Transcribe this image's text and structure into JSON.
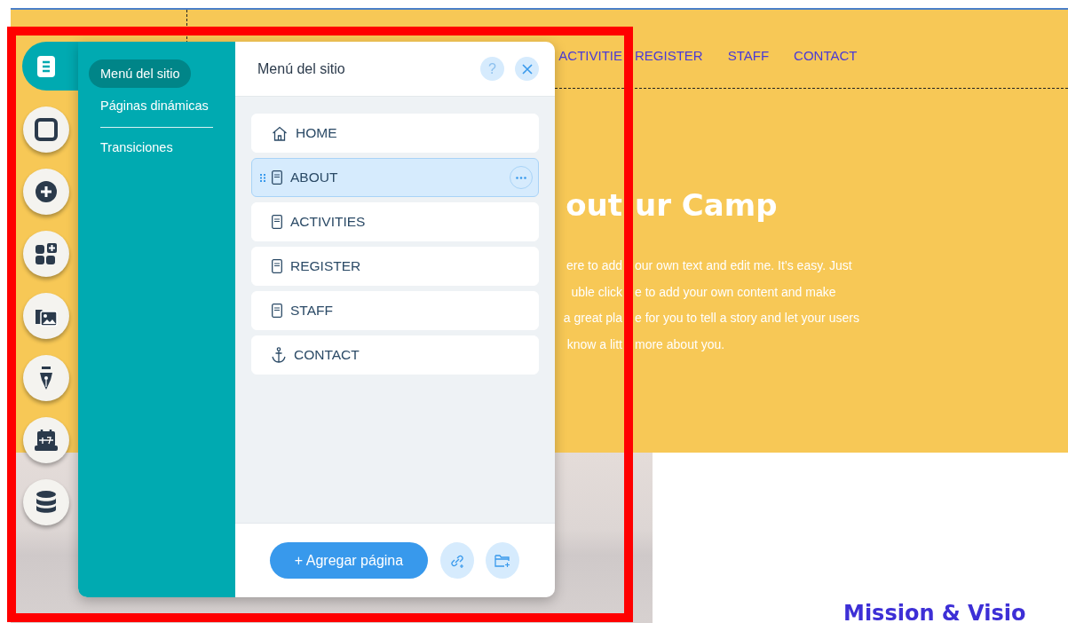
{
  "site": {
    "nav": [
      {
        "label": "ACTIVITIE"
      },
      {
        "label": "REGISTER"
      },
      {
        "label": "STAFF"
      },
      {
        "label": "CONTACT"
      }
    ],
    "heading": {
      "part_1": "out",
      "part_2": "ur Camp"
    },
    "paragraph_lines": [
      {
        "part_1": "ere to add",
        "part_2": "our own text and edit me. It’s easy. Just"
      },
      {
        "part_1": "uble click",
        "part_2": "e to add your own content and make"
      },
      {
        "part_1": "a great pla",
        "part_2": "e for you to tell a story and let your users"
      },
      {
        "part_1": "know a litt",
        "part_2": "more about you."
      }
    ],
    "subheading": "Mission & Visio"
  },
  "toolbar": {
    "items": [
      {
        "kind": "pages",
        "selected": true
      },
      {
        "kind": "box",
        "selected": false
      },
      {
        "kind": "add",
        "selected": false
      },
      {
        "kind": "apps",
        "selected": false
      },
      {
        "kind": "media",
        "selected": false
      },
      {
        "kind": "pen",
        "selected": false
      },
      {
        "kind": "calendar",
        "selected": false
      },
      {
        "kind": "database",
        "selected": false
      }
    ]
  },
  "menu": {
    "tabs": [
      {
        "label": "Menú del sitio",
        "selected": true
      },
      {
        "label": "Páginas dinámicas",
        "selected": false
      },
      {
        "label": "Transiciones",
        "selected": false
      }
    ]
  },
  "panel": {
    "title": "Menú del sitio",
    "help": "?",
    "pages": [
      {
        "label": "HOME",
        "kind": "home",
        "selected": false
      },
      {
        "label": "ABOUT",
        "kind": "page",
        "selected": true
      },
      {
        "label": "ACTIVITIES",
        "kind": "page",
        "selected": false
      },
      {
        "label": "REGISTER",
        "kind": "page",
        "selected": false
      },
      {
        "label": "STAFF",
        "kind": "page",
        "selected": false
      },
      {
        "label": "CONTACT",
        "kind": "anchor",
        "selected": false
      }
    ],
    "add_button": "+ Agregar página"
  }
}
